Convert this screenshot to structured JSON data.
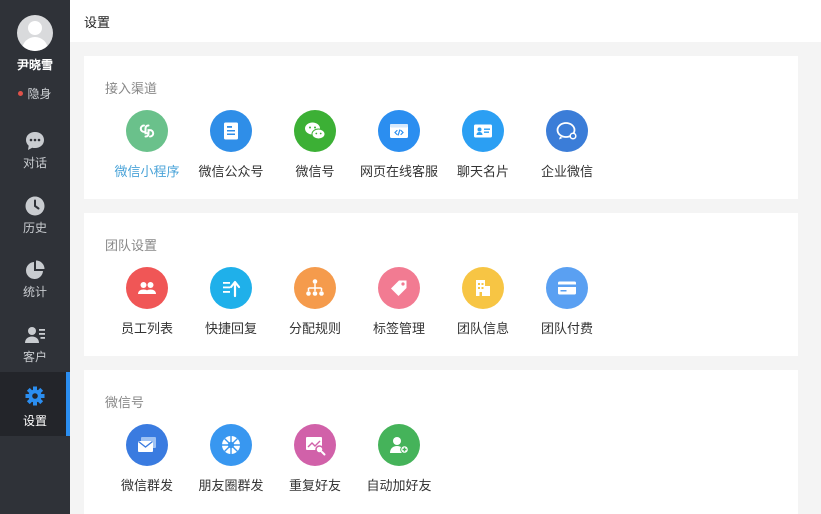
{
  "sidebar": {
    "user": {
      "name": "尹晓雪",
      "status": "隐身",
      "status_color": "#e0524a"
    },
    "nav": [
      {
        "label": "对话",
        "icon": "chat-bubble-icon"
      },
      {
        "label": "历史",
        "icon": "clock-icon"
      },
      {
        "label": "统计",
        "icon": "pie-chart-icon"
      },
      {
        "label": "客户",
        "icon": "contacts-icon"
      },
      {
        "label": "设置",
        "icon": "gear-icon",
        "active": true
      }
    ],
    "active_color": "#2b8ef0"
  },
  "header": {
    "title": "设置"
  },
  "sections": [
    {
      "title": "接入渠道",
      "items": [
        {
          "label": "微信小程序",
          "icon": "mini-program-icon",
          "color": "#6ac18b",
          "selected": true
        },
        {
          "label": "微信公众号",
          "icon": "official-account-icon",
          "color": "#2f8ee8"
        },
        {
          "label": "微信号",
          "icon": "wechat-icon",
          "color": "#3cb035"
        },
        {
          "label": "网页在线客服",
          "icon": "web-chat-icon",
          "color": "#2b8ef0"
        },
        {
          "label": "聊天名片",
          "icon": "business-card-icon",
          "color": "#2b9ff3"
        },
        {
          "label": "企业微信",
          "icon": "work-wechat-icon",
          "color": "#3b7dd8"
        }
      ]
    },
    {
      "title": "团队设置",
      "items": [
        {
          "label": "员工列表",
          "icon": "staff-icon",
          "color": "#f05656"
        },
        {
          "label": "快捷回复",
          "icon": "quick-reply-icon",
          "color": "#1fb0ea"
        },
        {
          "label": "分配规则",
          "icon": "distribution-icon",
          "color": "#f59b4c"
        },
        {
          "label": "标签管理",
          "icon": "tag-icon",
          "color": "#f27b92"
        },
        {
          "label": "团队信息",
          "icon": "building-icon",
          "color": "#f7c544"
        },
        {
          "label": "团队付费",
          "icon": "credit-card-icon",
          "color": "#5aa0f2"
        }
      ]
    },
    {
      "title": "微信号",
      "items": [
        {
          "label": "微信群发",
          "icon": "mass-message-icon",
          "color": "#3a7be0"
        },
        {
          "label": "朋友圈群发",
          "icon": "moments-icon",
          "color": "#3897f0"
        },
        {
          "label": "重复好友",
          "icon": "duplicate-friends-icon",
          "color": "#d161a9"
        },
        {
          "label": "自动加好友",
          "icon": "add-friend-icon",
          "color": "#45b35a"
        }
      ]
    }
  ]
}
